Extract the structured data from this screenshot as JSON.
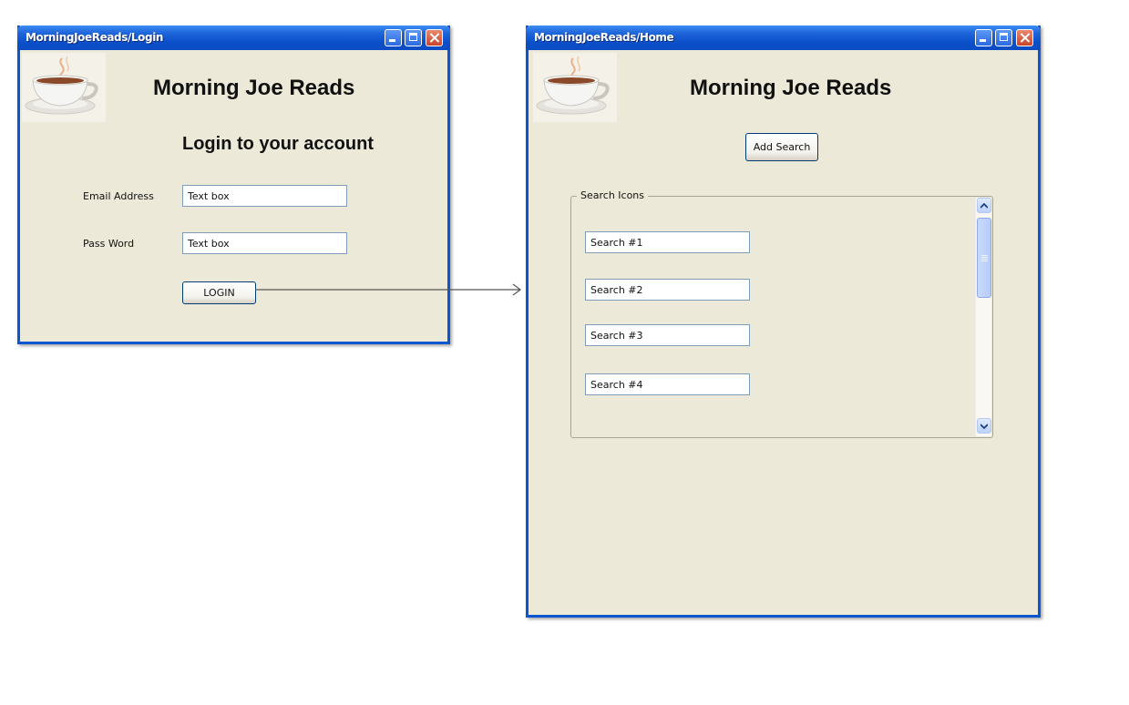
{
  "login_window": {
    "title": "MorningJoeReads/Login",
    "app_title": "Morning Joe Reads",
    "subtitle": "Login to your account",
    "email_label": "Email Address",
    "email_value": "Text box",
    "password_label": "Pass Word",
    "password_value": "Text box",
    "login_button": "LOGIN"
  },
  "home_window": {
    "title": "MorningJoeReads/Home",
    "app_title": "Morning Joe Reads",
    "add_search_button": "Add Search",
    "group_label": "Search Icons",
    "searches": [
      "Search #1",
      "Search #2",
      "Search #3",
      "Search #4"
    ]
  },
  "colors": {
    "window_bg": "#ECE9D8",
    "titlebar_blue": "#0A4FC9",
    "close_red": "#C8452A"
  },
  "icons": [
    "coffee-cup-logo",
    "minimize-icon",
    "maximize-icon",
    "close-icon",
    "arrow-right-icon",
    "scroll-up-icon",
    "scroll-down-icon"
  ]
}
